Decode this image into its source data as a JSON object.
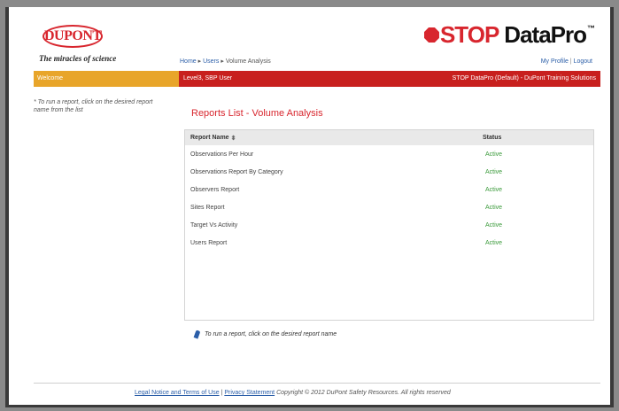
{
  "header": {
    "logo": "DUPONT",
    "tagline": "The miracles of science",
    "brand_stop": "STOP",
    "brand_datapro": "DataPro",
    "brand_tm": "™",
    "breadcrumb": {
      "home": "Home",
      "users": "Users",
      "current": "Volume Analysis",
      "sep": "▸"
    },
    "user_links": {
      "profile": "My Profile",
      "sep": "|",
      "logout": "Logout"
    }
  },
  "bars": {
    "welcome": "Welcome",
    "user": "Level3, SBP User",
    "org": "STOP DataPro (Default) - DuPont Training Solutions"
  },
  "left_note": "* To run a report, click on the desired report name from the list",
  "page_title": "Reports List - Volume Analysis",
  "table": {
    "headers": {
      "name": "Report Name",
      "status": "Status"
    },
    "rows": [
      {
        "name": "Observations Per Hour",
        "status": "Active"
      },
      {
        "name": "Observations Report By Category",
        "status": "Active"
      },
      {
        "name": "Observers Report",
        "status": "Active"
      },
      {
        "name": "Sites Report",
        "status": "Active"
      },
      {
        "name": "Target Vs Activity",
        "status": "Active"
      },
      {
        "name": "Users Report",
        "status": "Active"
      }
    ]
  },
  "hint": "To run a report, click on the desired report name",
  "footer": {
    "legal": "Legal Notice and Terms of Use",
    "sep": "|",
    "privacy": "Privacy Statement",
    "copyright": "Copyright © 2012 DuPont Safety Resources. All rights reserved"
  },
  "icons": {
    "sort": "sort-icon",
    "pin": "pin-icon",
    "stop": "stop-sign-icon"
  },
  "colors": {
    "brand_red": "#d8262e",
    "accent_orange": "#e8a52a",
    "status_green": "#3a9a3a",
    "link_blue": "#2b5ea8"
  }
}
